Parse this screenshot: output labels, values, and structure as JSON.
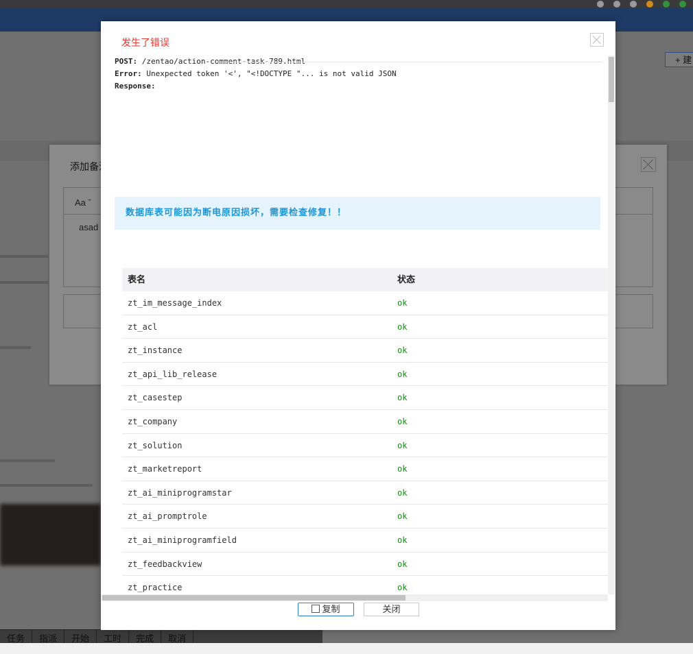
{
  "background": {
    "create_button": "+ 建",
    "comment_dialog": {
      "title": "添加备注",
      "font_button": "Aa ˇ",
      "editor_text": "asad"
    },
    "toolbar": [
      "任务",
      "指派",
      "开始",
      "工时",
      "完成",
      "取消"
    ]
  },
  "modal": {
    "title": "发生了错误",
    "post_label": "POST:",
    "post_url": "/zentao/action-comment-task-789.html",
    "error_label": "Error:",
    "error_text": "Unexpected token '<', \"<!DOCTYPE \"... is not valid JSON",
    "response_label": "Response:",
    "notice": "数据库表可能因为断电原因损坏，需要检查修复！！",
    "table": {
      "headers": [
        "表名",
        "状态"
      ],
      "rows": [
        [
          "zt_im_message_index",
          "ok"
        ],
        [
          "zt_acl",
          "ok"
        ],
        [
          "zt_instance",
          "ok"
        ],
        [
          "zt_api_lib_release",
          "ok"
        ],
        [
          "zt_casestep",
          "ok"
        ],
        [
          "zt_company",
          "ok"
        ],
        [
          "zt_solution",
          "ok"
        ],
        [
          "zt_marketreport",
          "ok"
        ],
        [
          "zt_ai_miniprogramstar",
          "ok"
        ],
        [
          "zt_ai_promptrole",
          "ok"
        ],
        [
          "zt_ai_miniprogramfield",
          "ok"
        ],
        [
          "zt_feedbackview",
          "ok"
        ],
        [
          "zt_practice",
          "ok"
        ]
      ]
    },
    "copy_button": "复制",
    "close_button": "关闭"
  },
  "colors": {
    "error_title": "#e53935",
    "notice_text": "#1e96d7",
    "notice_bg": "#e4f3fc",
    "status_ok": "#1b8a1b",
    "primary_border": "#2d7ed0"
  }
}
